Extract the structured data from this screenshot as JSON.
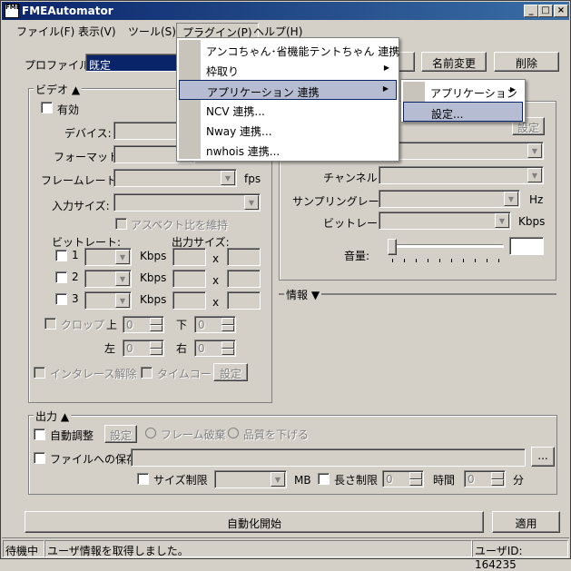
{
  "window": {
    "title": "FMEAutomator",
    "icon_text": "FME"
  },
  "menubar": [
    "ファイル(F)",
    "表示(V)",
    "ツール(S)",
    "プラグイン(P)",
    "ヘルプ(H)"
  ],
  "profile": {
    "label": "プロファイル:",
    "value": "既定",
    "rename": "名前変更",
    "delete": "削除"
  },
  "video": {
    "header": "ビデオ ▲",
    "enable": "有効",
    "device": "デバイス:",
    "format": "フォーマット:",
    "framerate": "フレームレート:",
    "fps": "fps",
    "input_size": "入力サイズ:",
    "aspect": "アスペクト比を維持",
    "bitrate": "ビットレート:",
    "output_size": "出力サイズ:",
    "rows": [
      "1",
      "2",
      "3"
    ],
    "kbps": "Kbps",
    "x": "x",
    "crop": "クロップ",
    "top": "上",
    "bottom": "下",
    "left": "左",
    "right": "右",
    "zero": "0",
    "deinterlace": "インタレース解除",
    "timecode": "タイムコード",
    "settings": "設定"
  },
  "audio": {
    "settings": "設定",
    "channel": "チャンネル:",
    "sampling": "サンプリングレート:",
    "hz": "Hz",
    "bitrate": "ビットレート:",
    "kbps": "Kbps",
    "volume": "音量:"
  },
  "info": {
    "header": "情報 ▼"
  },
  "output": {
    "header": "出力 ▲",
    "auto_adjust": "自動調整",
    "settings": "設定",
    "drop_frames": "フレーム破棄",
    "lower_quality": "品質を下げる",
    "save_file": "ファイルへの保存",
    "browse": "...",
    "size_limit": "サイズ制限",
    "mb": "MB",
    "length_limit": "長さ制限",
    "zero": "0",
    "hours": "時間",
    "minutes": "分"
  },
  "actions": {
    "start": "自動化開始",
    "apply": "適用"
  },
  "status": {
    "state": "待機中",
    "message": "ユーザ情報を取得しました。",
    "user": "ユーザID: 164235"
  },
  "plugin_menu": {
    "items": [
      "アンコちゃん･省機能テントちゃん 連携",
      "枠取り",
      "アプリケーション 連携",
      "NCV 連携...",
      "Nway 連携...",
      "nwhois 連携..."
    ],
    "sub1": [
      "アプリケーション"
    ],
    "sub2": [
      "設定..."
    ]
  }
}
